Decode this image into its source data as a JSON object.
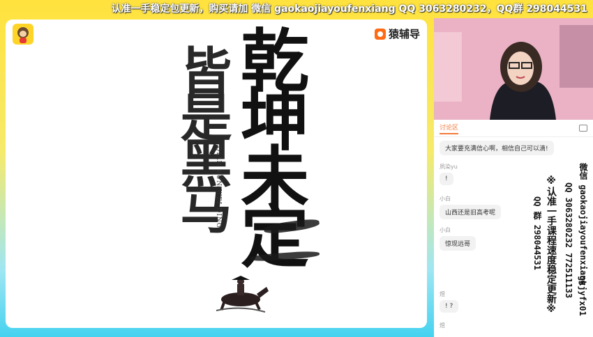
{
  "top_watermark": "认准一手稳定包更新，购买请加 微信 gaokaojiayoufenxiang QQ 3063280232，QQ群 298044531",
  "brand": {
    "name": "猿辅导"
  },
  "artwork": {
    "col1": "皆是黑马",
    "col2": "乾坤未定",
    "pinyin": "QIAN KUN WEI DING"
  },
  "chat": {
    "tab_label": "讨论区",
    "messages": [
      {
        "name": "",
        "text": "大家要充满信心啊，相信自己可以滴!"
      },
      {
        "name": "夙染yu",
        "text": "!"
      },
      {
        "name": "小白",
        "text": "山西还是旧高考呢"
      },
      {
        "name": "小白",
        "text": "惊现远哥"
      },
      {
        "name": "煜",
        "text": "! ?"
      },
      {
        "name": "煜",
        "text": ""
      }
    ]
  },
  "side_watermark": {
    "line1": "微信 gaokaojiayoufenxiang",
    "line2": "QQ 3063280232 772511133",
    "line3": "※认准一手课程速度稳定更新※",
    "line4": "QQ 群 298044531",
    "extra": "gkjyfx01"
  },
  "colors": {
    "accent": "#f47a3a",
    "brand_orange": "#ff6a14"
  }
}
